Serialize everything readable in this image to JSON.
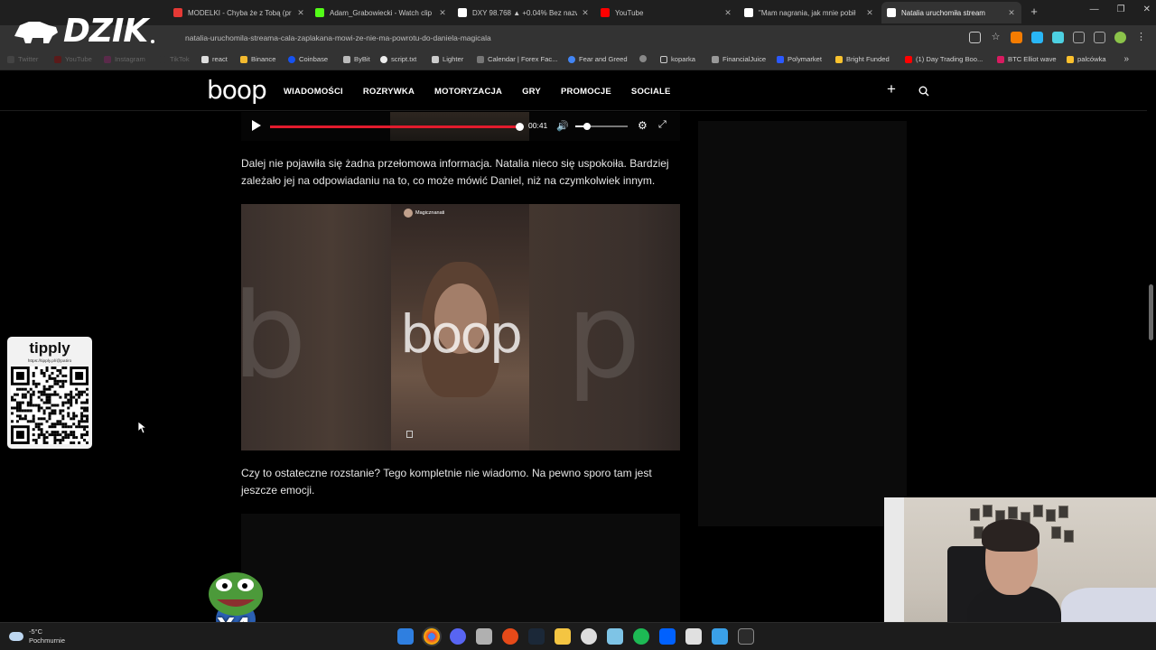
{
  "browser": {
    "tabs": [
      {
        "label": "",
        "active": false
      },
      {
        "label": "MODELKI - Chyba że z Tobą (pr",
        "active": false,
        "color": "#e53935"
      },
      {
        "label": "Adam_Grabowiecki - Watch clip",
        "active": false,
        "color": "#53fc18"
      },
      {
        "label": "DXY 98.768 ▲ +0.04% Bez nazw",
        "active": false,
        "color": "#ffffff"
      },
      {
        "label": "YouTube",
        "active": false,
        "color": "#ff0000"
      },
      {
        "label": "\"Mam nagrania, jak mnie pobił",
        "active": false,
        "color": "#ffffff"
      },
      {
        "label": "Natalia uruchomiła stream",
        "active": true,
        "color": "#ffffff"
      }
    ],
    "url": "natalia-uruchomila-streama-cala-zaplakana-mowi-ze-nie-ma-powrotu-do-daniela-magicala",
    "bookmarks": [
      {
        "label": "Twitter",
        "dim": true
      },
      {
        "label": "YouTube",
        "dim": true
      },
      {
        "label": "Instagram",
        "dim": true
      },
      {
        "label": "TikTok",
        "dim": true
      },
      {
        "label": "react"
      },
      {
        "label": "Binance"
      },
      {
        "label": "Coinbase"
      },
      {
        "label": "ByBit"
      },
      {
        "label": "script.txt"
      },
      {
        "label": "Lighter"
      },
      {
        "label": "Calendar | Forex Fac..."
      },
      {
        "label": "Fear and Greed"
      },
      {
        "label": ""
      },
      {
        "label": "koparka"
      },
      {
        "label": "FinancialJuice"
      },
      {
        "label": "Polymarket"
      },
      {
        "label": "Bright Funded"
      },
      {
        "label": "(1) Day Trading Boo..."
      },
      {
        "label": "BTC Elliot wave"
      },
      {
        "label": "palcówka"
      }
    ]
  },
  "overlay": {
    "brand": "DZIK",
    "tipply_title": "tipply",
    "tipply_url": "https://tipply.pl/@patiro",
    "emote_counter": "X4"
  },
  "site": {
    "logo": "boop",
    "nav": [
      "WIADOMOŚCI",
      "ROZRYWKA",
      "MOTORYZACJA",
      "GRY",
      "PROMOCJE",
      "SOCIALE"
    ]
  },
  "player": {
    "time": "00:41",
    "progress": 0.999,
    "volume": 0.22
  },
  "article": {
    "para1": "Dalej nie pojawiła się żadna przełomowa informacja. Natalia nieco się uspokoiła. Bardziej zależało jej na odpowiadaniu na to, co może mówić Daniel, niż na czymkolwiek innym.",
    "image_username": "Magicznanati",
    "image_watermark": "boop",
    "para2": "Czy to ostateczne rozstanie? Tego kompletnie nie wiadomo. Na pewno sporo tam jest jeszcze emocji."
  },
  "taskbar": {
    "temperature": "-5°C",
    "weather": "Pochmurnie",
    "apps": [
      "windows-start",
      "chrome",
      "discord",
      "app-generic",
      "app-chrome-alt",
      "steam",
      "file-explorer",
      "app-c",
      "app-tool",
      "spotify",
      "app-dropbox",
      "app-notes",
      "app-photo",
      "terminal"
    ]
  },
  "colors": {
    "accent": "#e21b2d",
    "page_bg": "#000000"
  }
}
